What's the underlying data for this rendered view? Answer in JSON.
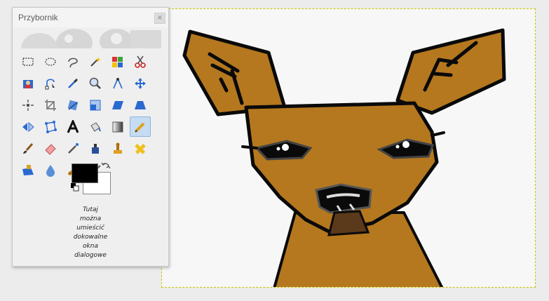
{
  "toolbox": {
    "title": "Przybornik",
    "close_glyph": "×",
    "dock_hint_lines": [
      "Tutaj",
      "można",
      "umieścić",
      "dokowalne",
      "okna",
      "dialogowe"
    ],
    "tools": [
      {
        "name": "rect-select-icon"
      },
      {
        "name": "ellipse-select-icon"
      },
      {
        "name": "free-select-icon"
      },
      {
        "name": "fuzzy-select-icon"
      },
      {
        "name": "color-select-icon"
      },
      {
        "name": "scissors-icon"
      },
      {
        "name": "foreground-select-icon"
      },
      {
        "name": "paths-icon"
      },
      {
        "name": "color-picker-icon"
      },
      {
        "name": "zoom-icon"
      },
      {
        "name": "measure-icon"
      },
      {
        "name": "move-icon"
      },
      {
        "name": "alignment-icon"
      },
      {
        "name": "crop-icon"
      },
      {
        "name": "rotate-icon"
      },
      {
        "name": "scale-icon"
      },
      {
        "name": "shear-icon"
      },
      {
        "name": "perspective-icon"
      },
      {
        "name": "flip-icon"
      },
      {
        "name": "cage-transform-icon"
      },
      {
        "name": "text-icon"
      },
      {
        "name": "bucket-fill-icon"
      },
      {
        "name": "gradient-icon"
      },
      {
        "name": "pencil-icon",
        "active": true
      },
      {
        "name": "paintbrush-icon"
      },
      {
        "name": "eraser-icon"
      },
      {
        "name": "airbrush-icon"
      },
      {
        "name": "ink-icon"
      },
      {
        "name": "clone-icon"
      },
      {
        "name": "heal-icon"
      },
      {
        "name": "perspective-clone-icon"
      },
      {
        "name": "blur-sharpen-icon"
      },
      {
        "name": "smudge-icon"
      },
      {
        "name": "dodge-burn-icon"
      }
    ],
    "colors": {
      "foreground": "#000000",
      "background": "#ffffff"
    }
  },
  "canvas": {
    "image": "deer-drawing",
    "colors": {
      "fur": "#b5781f",
      "outline": "#0a0a0a",
      "mouth": "#5a3a1a",
      "background": "#f7f7f7",
      "selection_border": "#c9c400"
    }
  }
}
